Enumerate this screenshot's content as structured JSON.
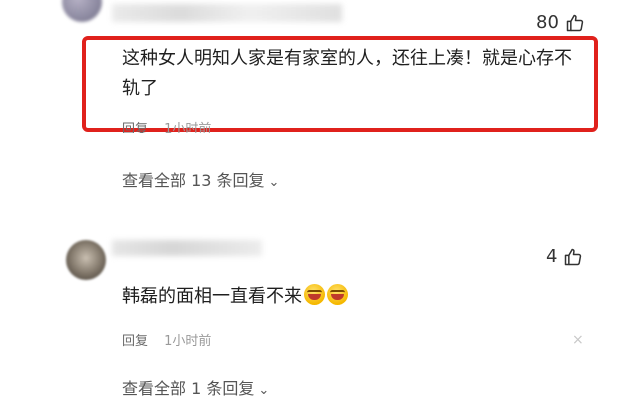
{
  "comments": [
    {
      "likes": "80",
      "text": "这种女人明知人家是有家室的人，还往上凑！就是心存不轨了",
      "reply_label": "回复",
      "time": "1小时前",
      "view_all": "查看全部 13 条回复",
      "highlighted": true,
      "highlight_color": "#e0211c"
    },
    {
      "likes": "4",
      "text": "韩磊的面相一直看不来",
      "emojis": [
        "laughing-tears-emoji",
        "laughing-tears-emoji"
      ],
      "reply_label": "回复",
      "time": "1小时前",
      "view_all": "查看全部 1 条回复",
      "close_glyph": "×"
    }
  ]
}
